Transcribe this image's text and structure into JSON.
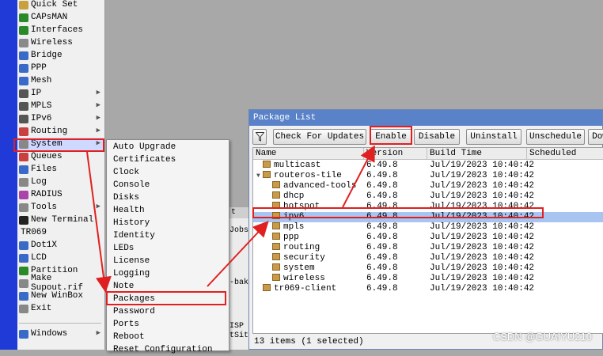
{
  "sidebar": {
    "items": [
      {
        "label": "Quick Set",
        "color": "#c8a040",
        "arrow": false
      },
      {
        "label": "CAPsMAN",
        "color": "#2a8a2a",
        "arrow": false
      },
      {
        "label": "Interfaces",
        "color": "#2a8a2a",
        "arrow": false
      },
      {
        "label": "Wireless",
        "color": "#8a8a8a",
        "arrow": false
      },
      {
        "label": "Bridge",
        "color": "#3a6ac8",
        "arrow": false
      },
      {
        "label": "PPP",
        "color": "#3a6ac8",
        "arrow": false
      },
      {
        "label": "Mesh",
        "color": "#3a6ac8",
        "arrow": false
      },
      {
        "label": "IP",
        "color": "#555555",
        "arrow": true
      },
      {
        "label": "MPLS",
        "color": "#555555",
        "arrow": true
      },
      {
        "label": "IPv6",
        "color": "#555555",
        "arrow": true
      },
      {
        "label": "Routing",
        "color": "#c84040",
        "arrow": true
      },
      {
        "label": "System",
        "color": "#888888",
        "arrow": true
      },
      {
        "label": "Queues",
        "color": "#c84040",
        "arrow": false
      },
      {
        "label": "Files",
        "color": "#3a6ac8",
        "arrow": false
      },
      {
        "label": "Log",
        "color": "#888888",
        "arrow": false
      },
      {
        "label": "RADIUS",
        "color": "#aa44aa",
        "arrow": false
      },
      {
        "label": "Tools",
        "color": "#888888",
        "arrow": true
      },
      {
        "label": "New Terminal",
        "color": "#222222",
        "arrow": false
      },
      {
        "label": "TR069",
        "color": "",
        "arrow": false
      },
      {
        "label": "Dot1X",
        "color": "#3a6ac8",
        "arrow": false
      },
      {
        "label": "LCD",
        "color": "#3a6ac8",
        "arrow": false
      },
      {
        "label": "Partition",
        "color": "#2a8a2a",
        "arrow": false
      },
      {
        "label": "Make Supout.rif",
        "color": "#888888",
        "arrow": false
      },
      {
        "label": "New WinBox",
        "color": "#3a6ac8",
        "arrow": false
      },
      {
        "label": "Exit",
        "color": "#888888",
        "arrow": false
      }
    ],
    "bottom": {
      "label": "Windows",
      "color": "#3a6ac8",
      "arrow": true
    }
  },
  "system_menu": {
    "items": [
      "Auto Upgrade",
      "Certificates",
      "Clock",
      "Console",
      "Disks",
      "Health",
      "History",
      "Identity",
      "LEDs",
      "License",
      "Logging",
      "Note",
      "Packages",
      "Password",
      "Ports",
      "Reboot",
      "Reset Configuration"
    ]
  },
  "background_window": {
    "texts": [
      "t",
      "Jobs",
      "-bak",
      "ISP",
      "tSite"
    ]
  },
  "package_window": {
    "title": "Package List",
    "buttons": [
      "Check For Updates",
      "Enable",
      "Disable",
      "Uninstall",
      "Unschedule",
      "Dow"
    ],
    "columns": [
      "Name",
      "Version",
      "Build Time",
      "Scheduled"
    ],
    "rows": [
      {
        "name": "multicast",
        "version": "6.49.8",
        "build": "Jul/19/2023 10:40:42",
        "indent": 0,
        "tree": false,
        "selected": false
      },
      {
        "name": "routeros-tile",
        "version": "6.49.8",
        "build": "Jul/19/2023 10:40:42",
        "indent": 0,
        "tree": true,
        "selected": false
      },
      {
        "name": "advanced-tools",
        "version": "6.49.8",
        "build": "Jul/19/2023 10:40:42",
        "indent": 1,
        "tree": false,
        "selected": false
      },
      {
        "name": "dhcp",
        "version": "6.49.8",
        "build": "Jul/19/2023 10:40:42",
        "indent": 1,
        "tree": false,
        "selected": false
      },
      {
        "name": "hotspot",
        "version": "6.49.8",
        "build": "Jul/19/2023 10:40:42",
        "indent": 1,
        "tree": false,
        "selected": false
      },
      {
        "name": "ipv6",
        "version": "6.49.8",
        "build": "Jul/19/2023 10:40:42",
        "indent": 1,
        "tree": false,
        "selected": true
      },
      {
        "name": "mpls",
        "version": "6.49.8",
        "build": "Jul/19/2023 10:40:42",
        "indent": 1,
        "tree": false,
        "selected": false
      },
      {
        "name": "ppp",
        "version": "6.49.8",
        "build": "Jul/19/2023 10:40:42",
        "indent": 1,
        "tree": false,
        "selected": false
      },
      {
        "name": "routing",
        "version": "6.49.8",
        "build": "Jul/19/2023 10:40:42",
        "indent": 1,
        "tree": false,
        "selected": false
      },
      {
        "name": "security",
        "version": "6.49.8",
        "build": "Jul/19/2023 10:40:42",
        "indent": 1,
        "tree": false,
        "selected": false
      },
      {
        "name": "system",
        "version": "6.49.8",
        "build": "Jul/19/2023 10:40:42",
        "indent": 1,
        "tree": false,
        "selected": false
      },
      {
        "name": "wireless",
        "version": "6.49.8",
        "build": "Jul/19/2023 10:40:42",
        "indent": 1,
        "tree": false,
        "selected": false
      },
      {
        "name": "tr069-client",
        "version": "6.49.8",
        "build": "Jul/19/2023 10:40:42",
        "indent": 0,
        "tree": false,
        "selected": false
      }
    ],
    "status": "13 items (1 selected)"
  },
  "colors": {
    "highlight": "#e02020",
    "titlebar": "#5a82c8",
    "selection": "#a8c4f0"
  },
  "watermark": "CSDN @GUAIYU210"
}
